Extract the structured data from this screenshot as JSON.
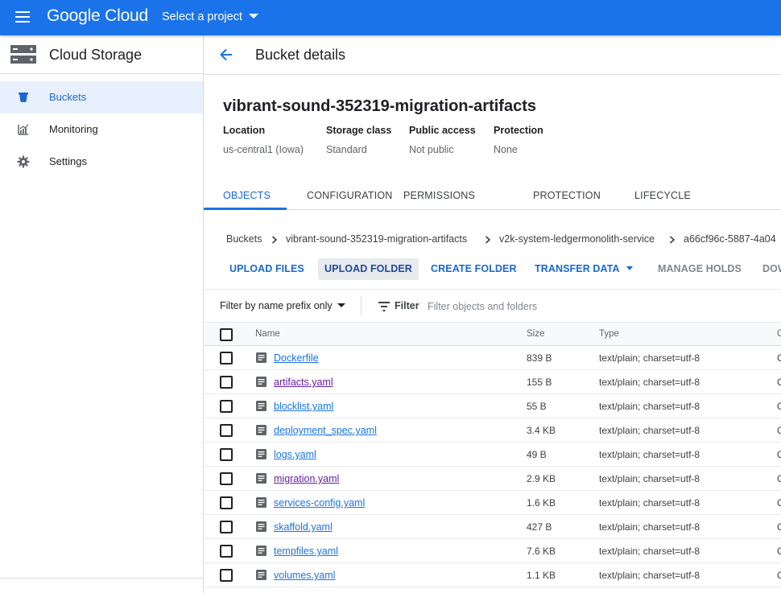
{
  "topbar": {
    "logo": "Google Cloud",
    "project_selector": "Select a project",
    "brand_color": "#1a73e8"
  },
  "sidebar": {
    "product_title": "Cloud Storage",
    "items": [
      {
        "label": "Buckets",
        "icon": "bucket-icon",
        "active": true
      },
      {
        "label": "Monitoring",
        "icon": "chart-icon",
        "active": false
      },
      {
        "label": "Settings",
        "icon": "gear-icon",
        "active": false
      }
    ]
  },
  "header": {
    "title": "Bucket details"
  },
  "bucket": {
    "name": "vibrant-sound-352319-migration-artifacts",
    "meta": [
      {
        "key": "Location",
        "value": "us-central1 (Iowa)"
      },
      {
        "key": "Storage class",
        "value": "Standard"
      },
      {
        "key": "Public access",
        "value": "Not public"
      },
      {
        "key": "Protection",
        "value": "None"
      }
    ]
  },
  "tabs": [
    "OBJECTS",
    "CONFIGURATION",
    "PERMISSIONS",
    "PROTECTION",
    "LIFECYCLE"
  ],
  "breadcrumb": [
    "Buckets",
    "vibrant-sound-352319-migration-artifacts",
    "v2k-system-ledgermonolith-service",
    "a66cf96c-5887-4a04"
  ],
  "actions": [
    "UPLOAD FILES",
    "UPLOAD FOLDER",
    "CREATE FOLDER",
    "TRANSFER DATA",
    "MANAGE HOLDS",
    "DOW"
  ],
  "filter": {
    "prefix_label": "Filter by name prefix only",
    "filter_label": "Filter",
    "placeholder": "Filter objects and folders"
  },
  "table": {
    "columns": [
      "Name",
      "Size",
      "Type",
      "C"
    ],
    "rows": [
      {
        "name": "Dockerfile",
        "size": "839 B",
        "type": "text/plain; charset=utf-8",
        "extra": "C",
        "visited": false
      },
      {
        "name": "artifacts.yaml",
        "size": "155 B",
        "type": "text/plain; charset=utf-8",
        "extra": "C",
        "visited": true
      },
      {
        "name": "blocklist.yaml",
        "size": "55 B",
        "type": "text/plain; charset=utf-8",
        "extra": "C",
        "visited": false
      },
      {
        "name": "deployment_spec.yaml",
        "size": "3.4 KB",
        "type": "text/plain; charset=utf-8",
        "extra": "C",
        "visited": false
      },
      {
        "name": "logs.yaml",
        "size": "49 B",
        "type": "text/plain; charset=utf-8",
        "extra": "C",
        "visited": false
      },
      {
        "name": "migration.yaml",
        "size": "2.9 KB",
        "type": "text/plain; charset=utf-8",
        "extra": "C",
        "visited": true
      },
      {
        "name": "services-config.yaml",
        "size": "1.6 KB",
        "type": "text/plain; charset=utf-8",
        "extra": "C",
        "visited": false
      },
      {
        "name": "skaffold.yaml",
        "size": "427 B",
        "type": "text/plain; charset=utf-8",
        "extra": "C",
        "visited": false
      },
      {
        "name": "tempfiles.yaml",
        "size": "7.6 KB",
        "type": "text/plain; charset=utf-8",
        "extra": "C",
        "visited": false
      },
      {
        "name": "volumes.yaml",
        "size": "1.1 KB",
        "type": "text/plain; charset=utf-8",
        "extra": "C",
        "visited": false
      }
    ]
  }
}
